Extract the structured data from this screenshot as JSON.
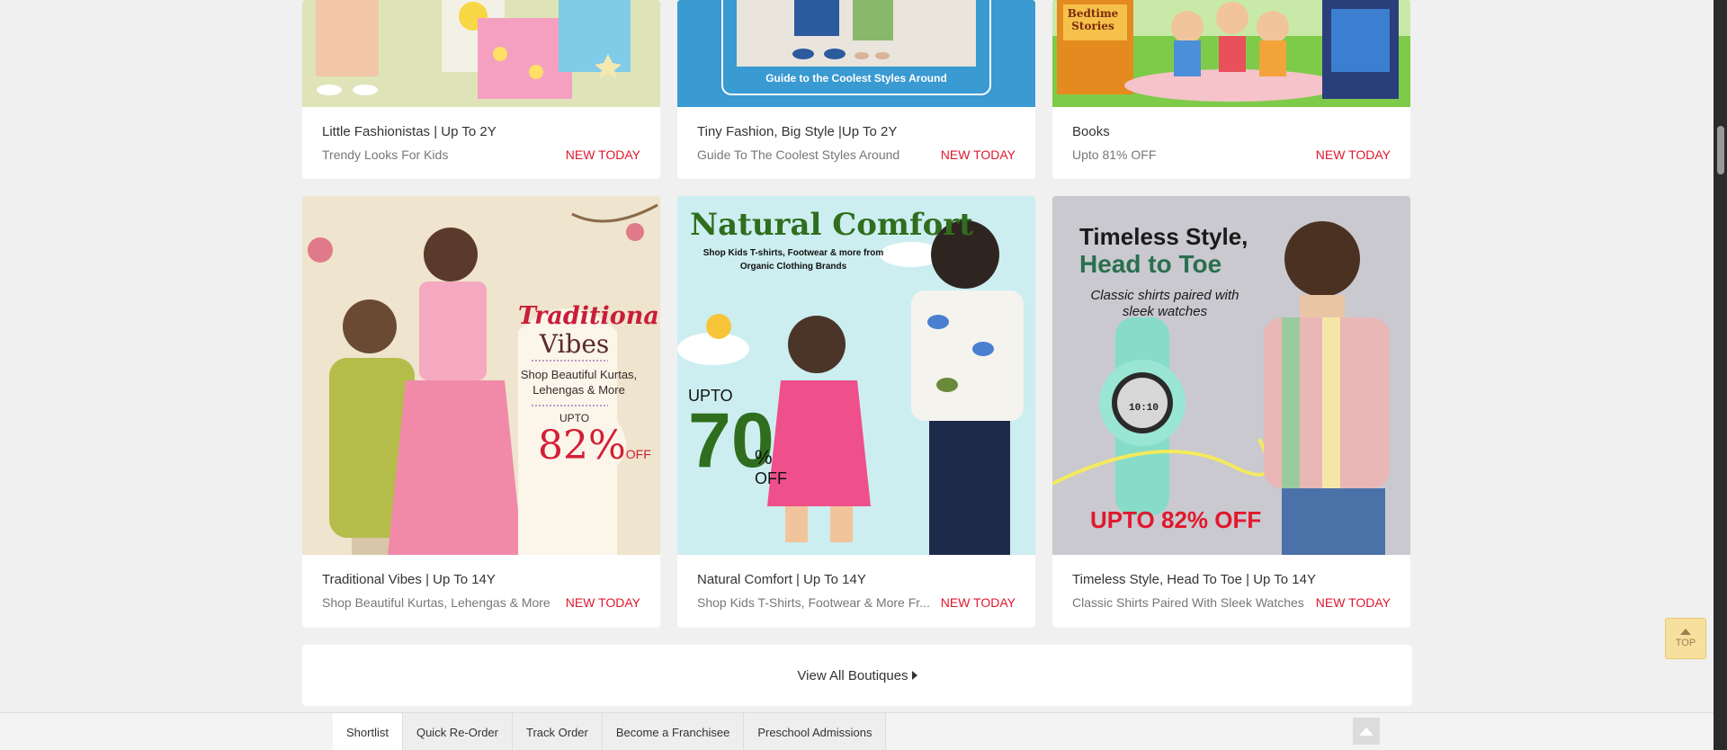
{
  "boutiques_row1": [
    {
      "title": "Little Fashionistas | Up To 2Y",
      "subtitle": "Trendy Looks For Kids",
      "badge": "NEW TODAY",
      "banner_bg": "#dfe3b8"
    },
    {
      "title": "Tiny Fashion, Big Style |Up To 2Y",
      "subtitle": "Guide To The Coolest Styles Around",
      "badge": "NEW TODAY",
      "banner_bg": "#3a9ad2",
      "banner_text": "Guide to the Coolest Styles Around"
    },
    {
      "title": "Books",
      "subtitle": "Upto 81% OFF",
      "badge": "NEW TODAY",
      "banner_bg": "#7ecb4a",
      "banner_text": "Bedtime Stories"
    }
  ],
  "boutiques_row2": [
    {
      "title": "Traditional Vibes | Up To 14Y",
      "subtitle": "Shop Beautiful Kurtas, Lehengas & More",
      "badge": "NEW TODAY",
      "banner_bg": "#efe4cd",
      "banner": {
        "heading1": "Traditional",
        "heading2": "Vibes",
        "line": "Shop Beautiful Kurtas, Lehengas & More",
        "upto": "UPTO",
        "pct": "82%",
        "off": "OFF"
      }
    },
    {
      "title": "Natural Comfort | Up To 14Y",
      "subtitle": "Shop Kids T-Shirts, Footwear & More Fr...",
      "badge": "NEW TODAY",
      "banner_bg": "#cdeef0",
      "banner": {
        "heading": "Natural Comfort",
        "line": "Shop Kids T-shirts, Footwear & more from Organic Clothing Brands",
        "upto": "UPTO",
        "pct": "70",
        "pct_sign": "%",
        "off": "OFF"
      }
    },
    {
      "title": "Timeless Style, Head To Toe | Up To 14Y",
      "subtitle": "Classic Shirts Paired With Sleek Watches",
      "badge": "NEW TODAY",
      "banner_bg": "#c9c9cf",
      "banner": {
        "heading1": "Timeless Style,",
        "heading2": "Head to Toe",
        "line": "Classic shirts paired with sleek watches",
        "offer": "UPTO 82% OFF",
        "watch": "10:10"
      }
    }
  ],
  "view_all": {
    "label": "View All Boutiques"
  },
  "top_button": {
    "label": "TOP"
  },
  "bottom_nav": [
    "Shortlist",
    "Quick Re-Order",
    "Track Order",
    "Become a Franchisee",
    "Preschool Admissions"
  ],
  "colors": {
    "badge": "#e0182d",
    "page_bg": "#f0f0f0"
  }
}
